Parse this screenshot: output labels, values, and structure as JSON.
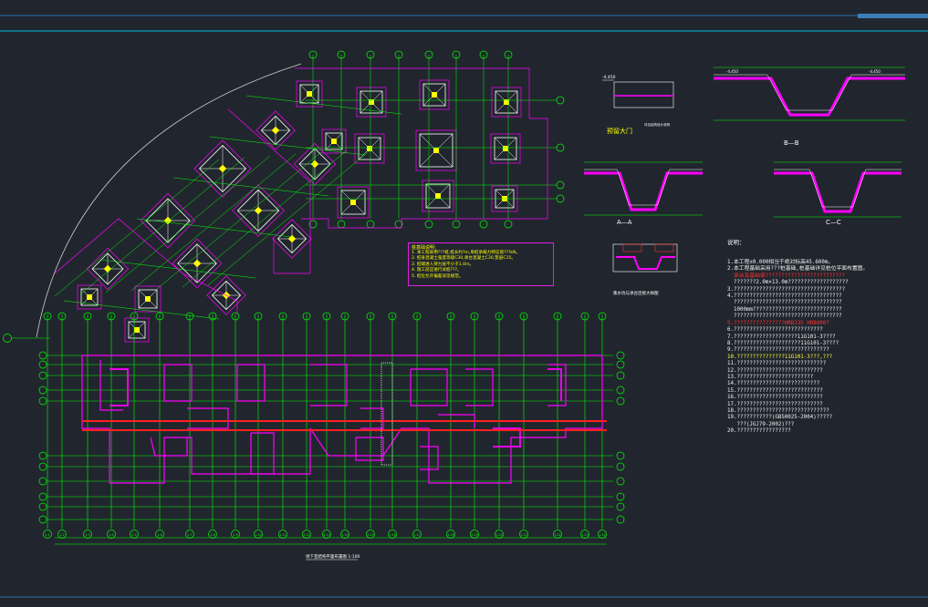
{
  "drawing": {
    "main_plan_caption": "地下室结构平面布置图 1:100",
    "detail_title_slab": "预留大门",
    "section_labels": [
      "A—A",
      "B—B",
      "C—C"
    ],
    "detail_caption_mid": "集水坑与承台连接大样图",
    "detail_caption_slab_note": "详见结构设计说明",
    "elev_marks": [
      "-4.450",
      "-4.450",
      "-4.450"
    ]
  },
  "pile_note": {
    "title": "桩基础说明：",
    "lines": [
      "1. 本工程采用???桩,桩长约?m,单桩承载力特征值???kN。",
      "2. 桩身混凝土强度等级C30,承台混凝土C30,垫层C15。",
      "3. 桩端进入持力层不小于1.0m。",
      "4. 施工前应进行试桩???。",
      "5. 桩位允许偏差详见规范。"
    ]
  },
  "general_notes": {
    "title": "说明：",
    "lines": [
      {
        "t": "1.本工程±0.000相当于绝对标高45.600m。",
        "c": "w"
      },
      {
        "t": "2.本工程基础采用???桩基础,桩基础详见桩位平面布置图。",
        "c": "w"
      },
      {
        "t": "  承台及基础梁?????????????????????????",
        "c": "r"
      },
      {
        "t": "  ???????2.0m×13.0m???????????????????",
        "c": "w"
      },
      {
        "t": "3.???????????????????????????????????",
        "c": "w"
      },
      {
        "t": "4.??????????????????????????????????",
        "c": "w"
      },
      {
        "t": "  ??????????????????????????????????",
        "c": "w"
      },
      {
        "t": "  1000mm????????????????????????????",
        "c": "w"
      },
      {
        "t": "  ??????????????????????????????????",
        "c": "w"
      },
      {
        "t": "5.????????????????HRB335 HRB400?",
        "c": "r"
      },
      {
        "t": "6.????????????????????????????",
        "c": "w"
      },
      {
        "t": "7.????????????????????11G101-3????",
        "c": "w"
      },
      {
        "t": "8.?????????????????????11G101-3????",
        "c": "w"
      },
      {
        "t": "9.??????????????????????????????",
        "c": "w"
      },
      {
        "t": "10.???????????????11G101-3???,???",
        "c": "y"
      },
      {
        "t": "11.????????????????????????????",
        "c": "w"
      },
      {
        "t": "12.???????????????????????????",
        "c": "w"
      },
      {
        "t": "13.????????????????????????",
        "c": "w"
      },
      {
        "t": "14.??????????????????????????",
        "c": "w"
      },
      {
        "t": "15.???????????????????????????",
        "c": "w"
      },
      {
        "t": "16.???????????????????????????",
        "c": "w"
      },
      {
        "t": "17.???????????????????????????",
        "c": "w"
      },
      {
        "t": "18.?????????????????????????????",
        "c": "w"
      },
      {
        "t": "19.???????????(GB50025-2004)?????",
        "c": "w"
      },
      {
        "t": "   ???(JGJ79-2002)???",
        "c": "w"
      },
      {
        "t": "20.?????????????????",
        "c": "w"
      }
    ]
  },
  "axis_labels_bottom": [
    "1-1",
    "1-2",
    "1-3",
    "1-4",
    "1-5",
    "1-6",
    "1-7",
    "1-8",
    "1-9",
    "1-10",
    "1-11",
    "1-12",
    "1-13",
    "1-14",
    "1-15",
    "1-16",
    "1-17",
    "1-18",
    "1-19",
    "1-20",
    "1-21",
    "1-22",
    "1-23",
    "1-24"
  ],
  "colors": {
    "background": "#21262e",
    "axis": "#00ff00",
    "wall": "#ff00ff",
    "beam_red": "#ff2020",
    "text": "#ffffff",
    "note": "#ffff00",
    "cyan": "#00d8ff"
  }
}
